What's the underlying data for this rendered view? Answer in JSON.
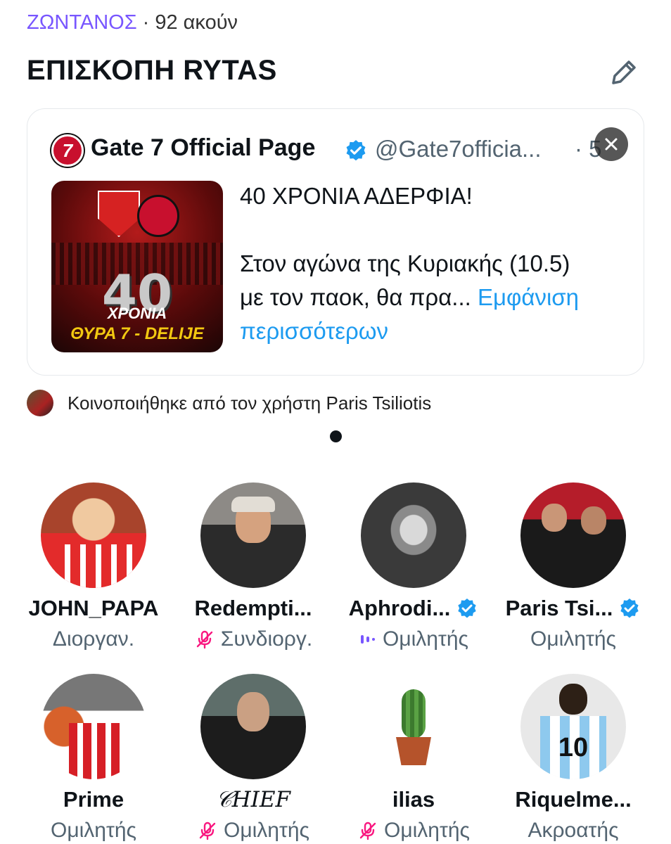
{
  "status": {
    "live_label": "ΖΩΝΤΑΝΟΣ",
    "separator": "·",
    "listeners": "92 ακούν"
  },
  "space": {
    "title": "ΕΠΙΣΚΟΠΗ RYTAS"
  },
  "pinned_tweet": {
    "author_name": "Gate 7 Official Page",
    "handle": "@Gate7officia...",
    "time": "· 5",
    "image_text": {
      "number": "40",
      "word": "ΧΡΟΝΙΑ",
      "banner": "ΘΥΡΑ 7 - DELIJE"
    },
    "text_line1": "40 ΧΡΟΝΙΑ ΑΔΕΡΦΙΑ!",
    "text_line2": "Στον αγώνα της Κυριακής (10.5)",
    "text_line3": "με τον παοκ, θα πρα...",
    "more_label": "Εμφάνιση περισσότερων"
  },
  "shared_by": {
    "text": "Κοινοποιήθηκε από τον χρήστη Paris Tsiliotis"
  },
  "participants": [
    {
      "name": "JOHN_PAPA",
      "role": "Διοργαν.",
      "verified": false,
      "role_icon": "none"
    },
    {
      "name": "Redempti...",
      "role": "Συνδιοργ.",
      "verified": false,
      "role_icon": "mic-muted-icon"
    },
    {
      "name": "Aphrodi...",
      "role": "Ομιλητής",
      "verified": true,
      "role_icon": "speaking-bars-icon"
    },
    {
      "name": "Paris Tsi...",
      "role": "Ομιλητής",
      "verified": true,
      "role_icon": "none"
    },
    {
      "name": "Prime",
      "role": "Ομιλητής",
      "verified": false,
      "role_icon": "none"
    },
    {
      "name": "𝒞HIEF",
      "role": "Ομιλητής",
      "verified": false,
      "role_icon": "mic-muted-icon"
    },
    {
      "name": "ilias",
      "role": "Ομιλητής",
      "verified": false,
      "role_icon": "mic-muted-icon"
    },
    {
      "name": "Riquelme...",
      "role": "Ακροατής",
      "verified": false,
      "role_icon": "none"
    }
  ],
  "colors": {
    "live": "#7856ff",
    "verified": "#1d9bf0",
    "muted_mic": "#f91880",
    "speaking": "#7856ff",
    "secondary_text": "#536471"
  }
}
